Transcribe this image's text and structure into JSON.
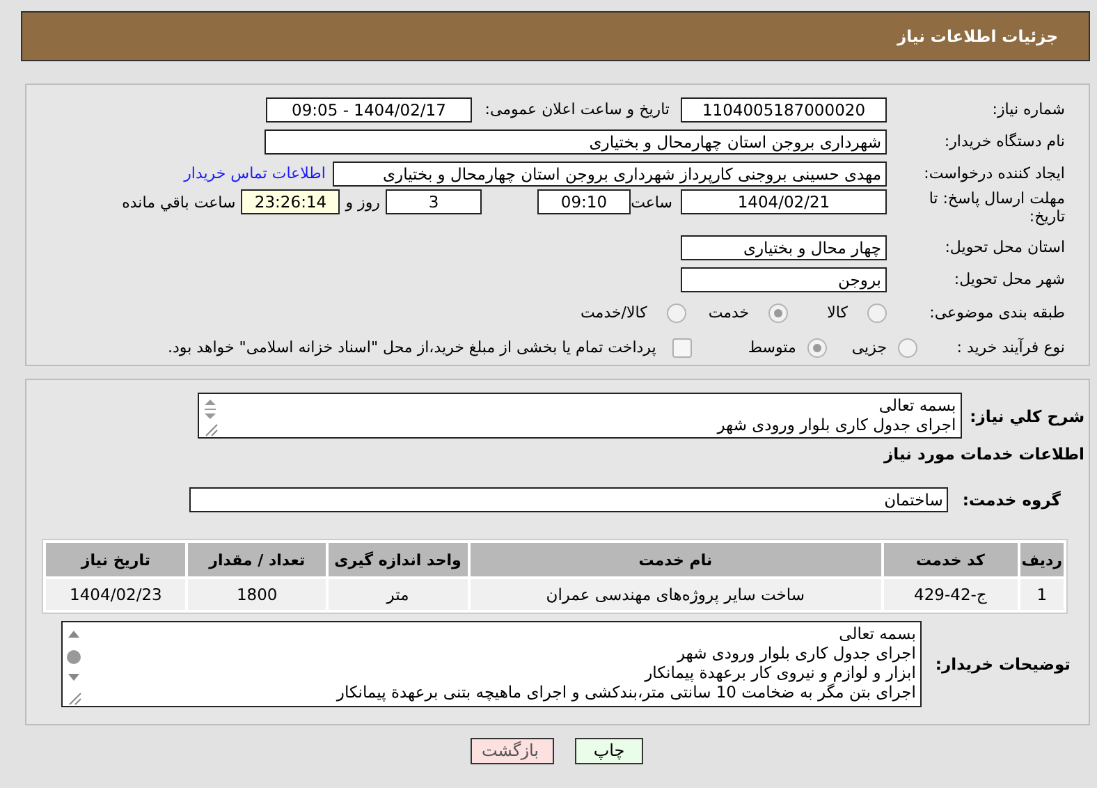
{
  "header": {
    "title": "جزئیات اطلاعات نیاز"
  },
  "need_info": {
    "need_number": {
      "label": "شماره نیاز:",
      "value": "1104005187000020"
    },
    "announce": {
      "label": "تاریخ و ساعت اعلان عمومی:",
      "value": "1404/02/17 - 09:05"
    },
    "buyer_org": {
      "label": "نام دستگاه خریدار:",
      "value": "شهرداری بروجن استان چهارمحال و بختیاری"
    },
    "requester": {
      "label": "ایجاد کننده درخواست:",
      "value": "مهدی حسینی بروجنی کارپرداز شهرداری بروجن استان چهارمحال و بختیاری",
      "link": "اطلاعات تماس خریدار"
    },
    "deadline": {
      "label": "مهلت ارسال پاسخ: تا تاریخ:",
      "date": "1404/02/21",
      "time_label": "ساعت",
      "time": "09:10",
      "days": "3",
      "days_label": "روز و",
      "remaining": "23:26:14",
      "remaining_label": "ساعت باقي مانده"
    },
    "province": {
      "label": "استان محل تحویل:",
      "value": "چهار محال و بختیاری"
    },
    "city": {
      "label": "شهر محل تحویل:",
      "value": "بروجن"
    },
    "category": {
      "label": "طبقه بندی موضوعی:",
      "options": [
        {
          "label": "کالا",
          "selected": false
        },
        {
          "label": "خدمت",
          "selected": true
        },
        {
          "label": "کالا/خدمت",
          "selected": false
        }
      ]
    },
    "purchase_type": {
      "label": "نوع فرآیند خرید :",
      "options": [
        {
          "label": "جزیی",
          "selected": false
        },
        {
          "label": "متوسط",
          "selected": true
        }
      ],
      "treasury": {
        "label": "پرداخت تمام یا بخشی از مبلغ خرید،از محل \"اسناد خزانه اسلامی\" خواهد بود.",
        "checked": false
      }
    }
  },
  "services": {
    "description": {
      "label": "شرح کلي نیاز:",
      "lines": [
        "بسمه تعالی",
        "اجرای جدول کاری بلوار ورودی شهر"
      ]
    },
    "heading": "اطلاعات خدمات مورد نیاز",
    "group": {
      "label": "گروه خدمت:",
      "value": "ساختمان"
    },
    "table": {
      "columns": [
        "ردیف",
        "کد خدمت",
        "نام خدمت",
        "واحد اندازه گیری",
        "تعداد / مقدار",
        "تاریخ نیاز"
      ],
      "rows": [
        [
          "1",
          "ج-42-429",
          "ساخت سایر پروژه‌های مهندسی عمران",
          "متر",
          "1800",
          "1404/02/23"
        ]
      ]
    },
    "notes": {
      "label": "توضیحات خریدار:",
      "lines": [
        "بسمه تعالی",
        "اجرای جدول کاری بلوار ورودی شهر",
        "ابزار و لوازم و نیروی کار برعهدة پیمانکار",
        "اجرای بتن مگر به ضخامت 10 سانتی متر،بندکشی و اجرای ماهیچه بتنی برعهدة پیمانکار"
      ]
    }
  },
  "buttons": [
    {
      "label": "چاپ",
      "kind": "print"
    },
    {
      "label": "بازگشت",
      "kind": "back"
    }
  ]
}
